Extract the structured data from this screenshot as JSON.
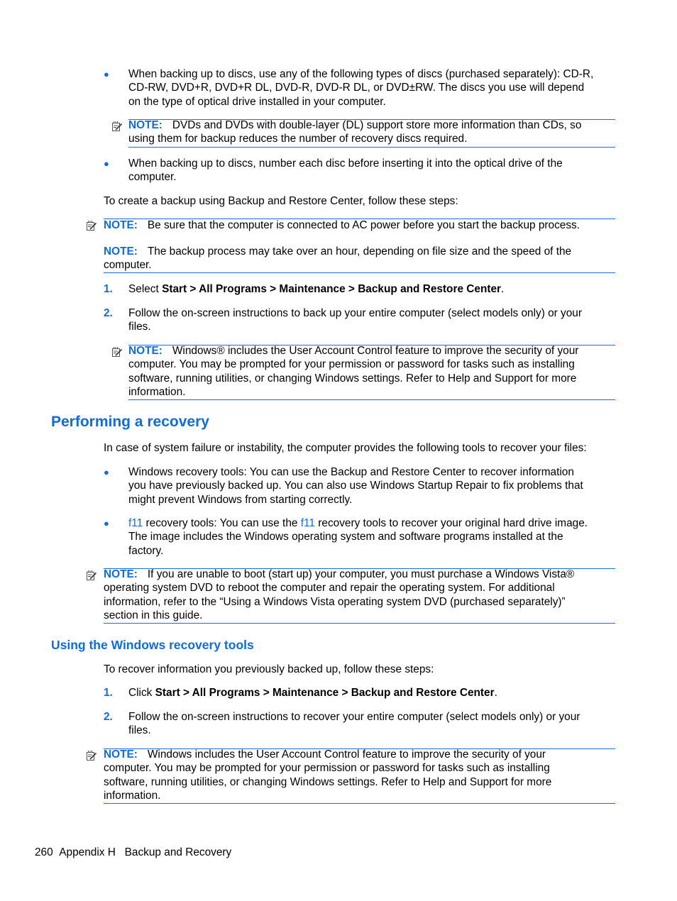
{
  "colors": {
    "accent": "#0e6be0",
    "text": "#000000"
  },
  "icons": {
    "note": "note-pencil-icon",
    "bullet": "●"
  },
  "note_label": "NOTE:",
  "bullets_top": [
    "When backing up to discs, use any of the following types of discs (purchased separately): CD-R,",
    "CD-RW, DVD+R, DVD+R DL, DVD-R, DVD-R DL, or DVD±RW. The discs you use will depend",
    "on the type of optical drive installed in your computer."
  ],
  "note1": {
    "line1": "DVDs and DVDs with double-layer (DL) support store more information than CDs, so",
    "line2": "using them for backup reduces the number of recovery discs required."
  },
  "bullet2": {
    "line1": "When backing up to discs, number each disc before inserting it into the optical drive of the",
    "line2": "computer."
  },
  "intro_backup": "To create a backup using Backup and Restore Center, follow these steps:",
  "note2": "Be sure that the computer is connected to AC power before you start the backup process.",
  "note3": {
    "line1": "The backup process may take over an hour, depending on file size and the speed of the",
    "line2": "computer."
  },
  "backup_steps": [
    {
      "num": "1.",
      "prefix": "Select ",
      "bold": "Start > All Programs > Maintenance > Backup and Restore Center",
      "suffix": "."
    },
    {
      "num": "2.",
      "line1": "Follow the on-screen instructions to back up your entire computer (select models only) or your",
      "line2": "files."
    }
  ],
  "note4": [
    "Windows® includes the User Account Control feature to improve the security of your",
    "computer. You may be prompted for your permission or password for tasks such as installing",
    "software, running utilities, or changing Windows settings. Refer to Help and Support for more",
    "information."
  ],
  "section_heading": "Performing a recovery",
  "recovery_intro": "In case of system failure or instability, the computer provides the following tools to recover your files:",
  "recovery_bullets": {
    "windows": [
      "Windows recovery tools: You can use the Backup and Restore Center to recover information",
      "you have previously backed up. You can also use Windows Startup Repair to fix problems that",
      "might prevent Windows from starting correctly."
    ],
    "f11": {
      "key": "f11",
      "part1": " recovery tools: You can use the ",
      "part2": " recovery tools to recover your original hard drive image.",
      "line2": "The image includes the Windows operating system and software programs installed at the",
      "line3": "factory."
    }
  },
  "note5": [
    "If you are unable to boot (start up) your computer, you must purchase a Windows Vista®",
    "operating system DVD to reboot the computer and repair the operating system. For additional",
    "information, refer to the “Using a Windows Vista operating system DVD (purchased separately)”",
    "section in this guide."
  ],
  "subsection_heading": "Using the Windows recovery tools",
  "recover_intro": "To recover information you previously backed up, follow these steps:",
  "recover_steps": [
    {
      "num": "1.",
      "prefix": "Click ",
      "bold": "Start > All Programs > Maintenance > Backup and Restore Center",
      "suffix": "."
    },
    {
      "num": "2.",
      "line1": "Follow the on-screen instructions to recover your entire computer (select models only) or your",
      "line2": "files."
    }
  ],
  "note6": [
    "Windows includes the User Account Control feature to improve the security of your",
    "computer. You may be prompted for your permission or password for tasks such as installing",
    "software, running utilities, or changing Windows settings. Refer to Help and Support for more",
    "information."
  ],
  "footer": {
    "page_number": "260",
    "chapter": "Appendix H",
    "title": "Backup and Recovery"
  }
}
